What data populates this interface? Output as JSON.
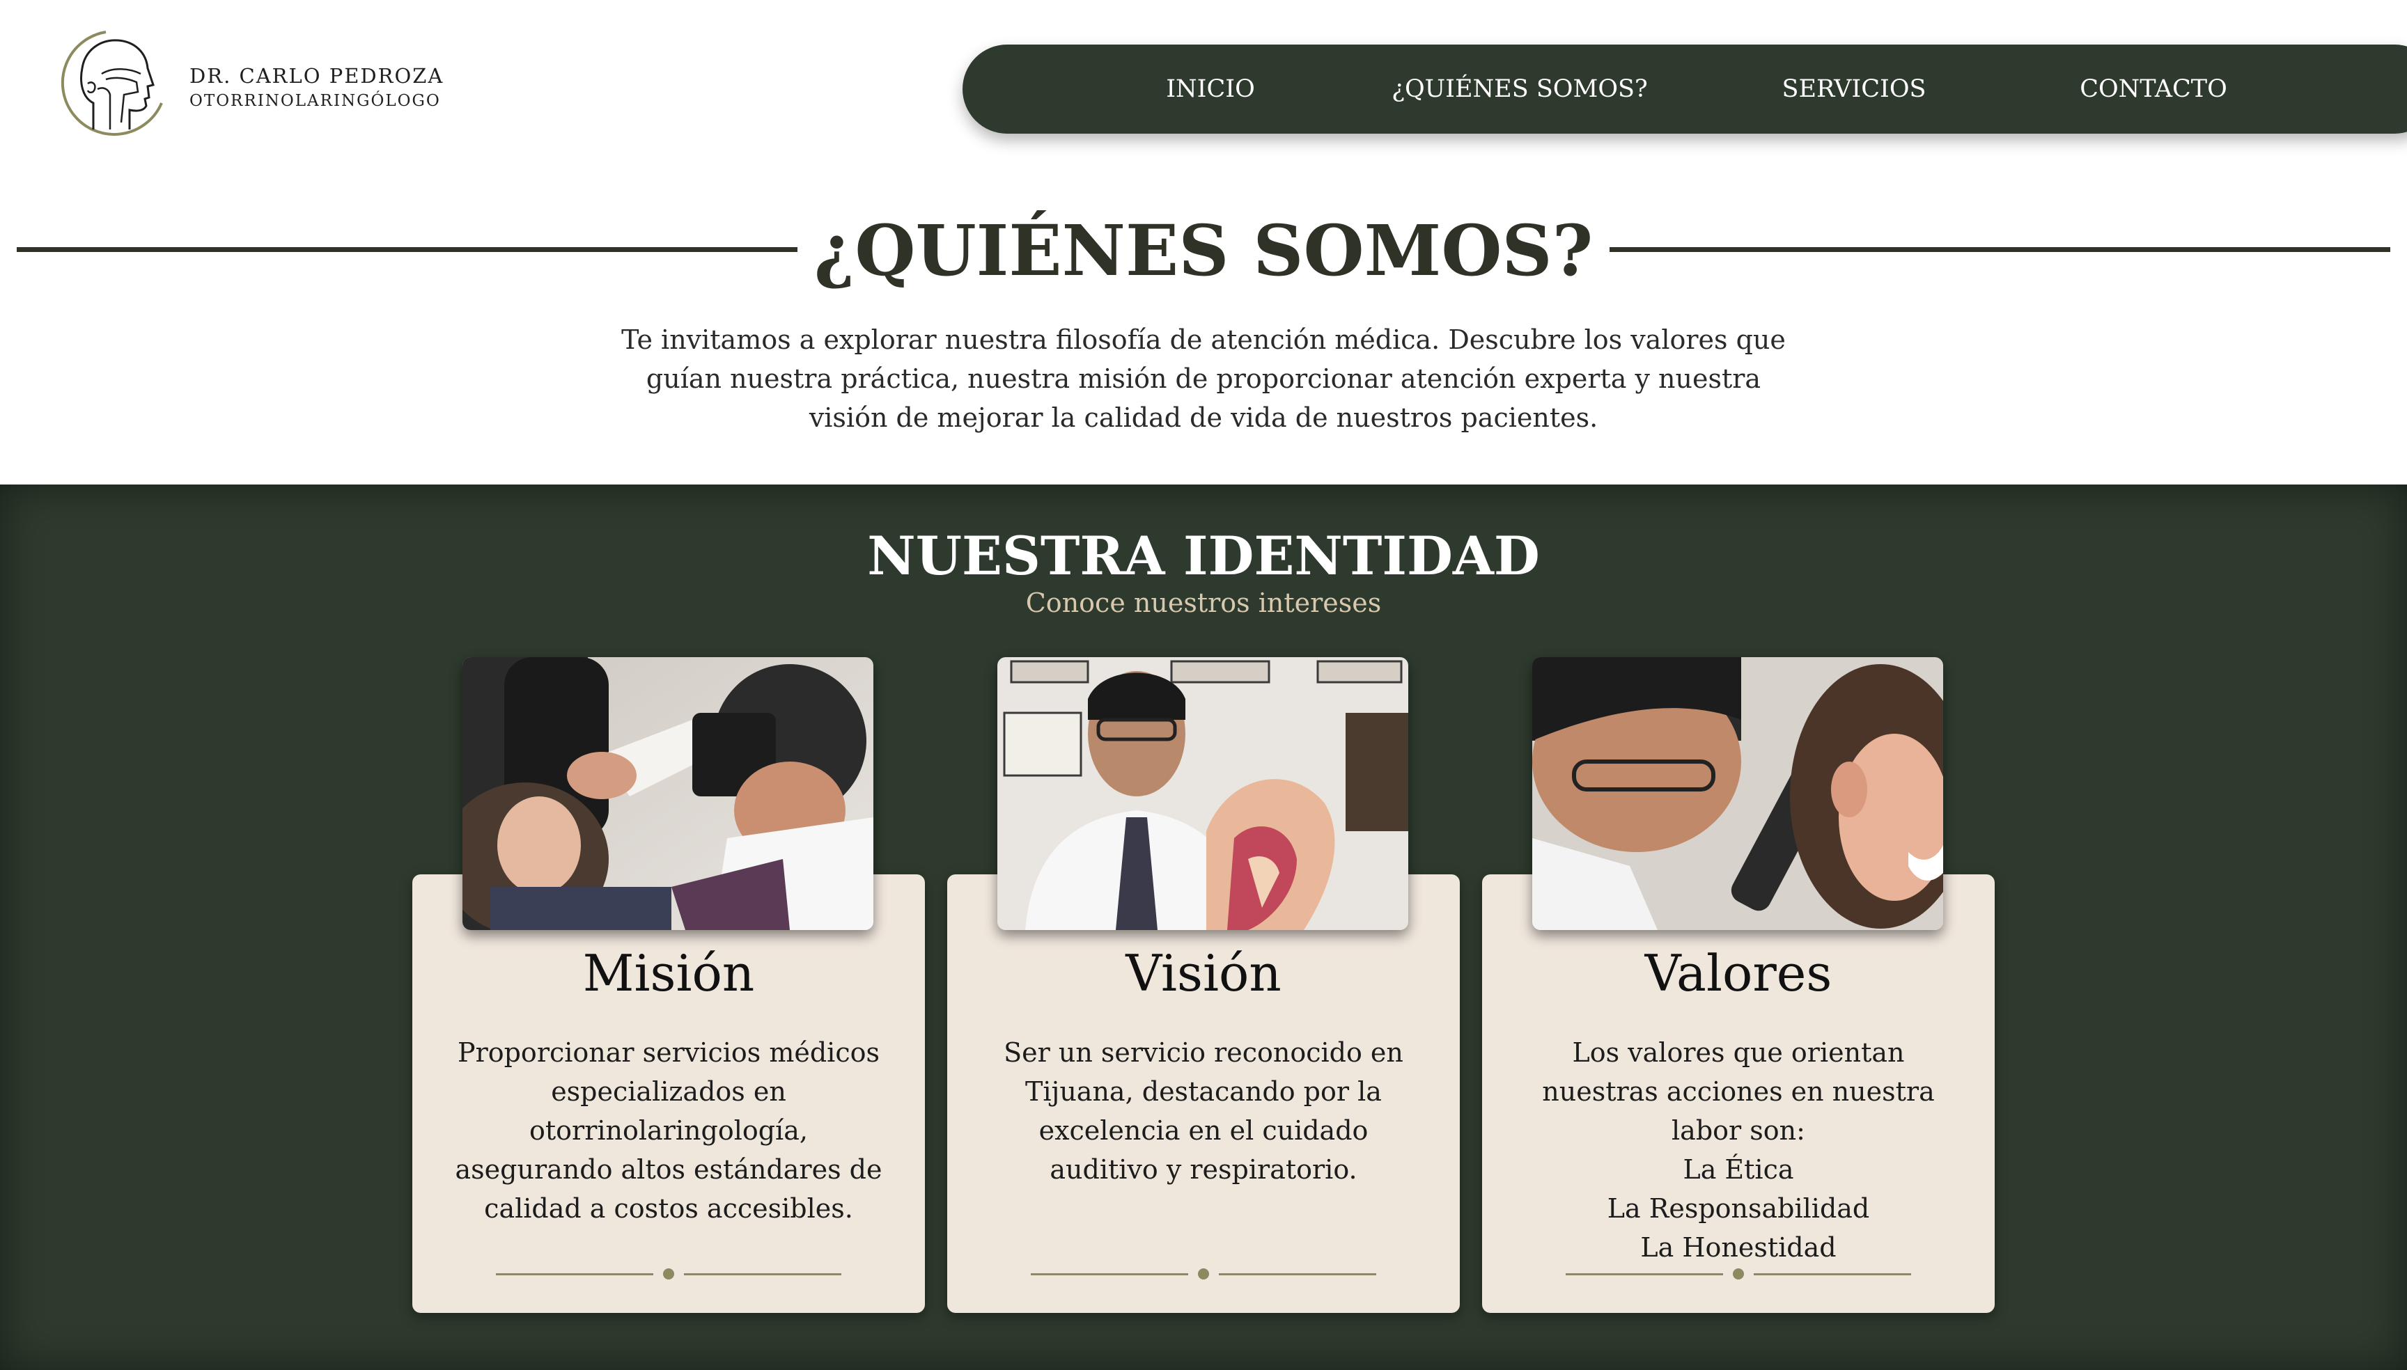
{
  "brand": {
    "name": "DR. CARLO PEDROZA",
    "subtitle": "OTORRINOLARINGÓLOGO",
    "logo_icon": "head-profile-icon"
  },
  "nav": {
    "items": [
      {
        "label": "INICIO"
      },
      {
        "label": "¿QUIÉNES SOMOS?"
      },
      {
        "label": "SERVICIOS"
      },
      {
        "label": "CONTACTO"
      }
    ]
  },
  "about": {
    "title": "¿QUIÉNES SOMOS?",
    "text": "Te invitamos a explorar nuestra filosofía de atención médica. Descubre los valores que guían nuestra práctica, nuestra misión de proporcionar atención experta y nuestra visión de mejorar la calidad de vida de nuestros pacientes."
  },
  "identity": {
    "title": "NUESTRA IDENTIDAD",
    "subtitle": "Conoce nuestros intereses",
    "cards": [
      {
        "title": "Misión",
        "photo_icon": "ear-exam-photo",
        "text": "Proporcionar servicios médicos especializados en otorrinolaringología, asegurando altos estándares de calidad a costos accesibles.",
        "lines": []
      },
      {
        "title": "Visión",
        "photo_icon": "doctor-portrait-photo",
        "text": "Ser un servicio reconocido en Tijuana, destacando por la excelencia en el cuidado auditivo y respiratorio.",
        "lines": []
      },
      {
        "title": "Valores",
        "photo_icon": "otoscope-exam-photo",
        "text": "Los valores que orientan nuestras acciones en nuestra labor son:",
        "lines": [
          "La Ética",
          "La Responsabilidad",
          "La Honestidad"
        ]
      }
    ]
  },
  "colors": {
    "dark_green": "#2d3a2d",
    "card_bg": "#efe6dc",
    "accent_olive": "#8c8a5e",
    "subtitle_tan": "#d8c9ae"
  }
}
